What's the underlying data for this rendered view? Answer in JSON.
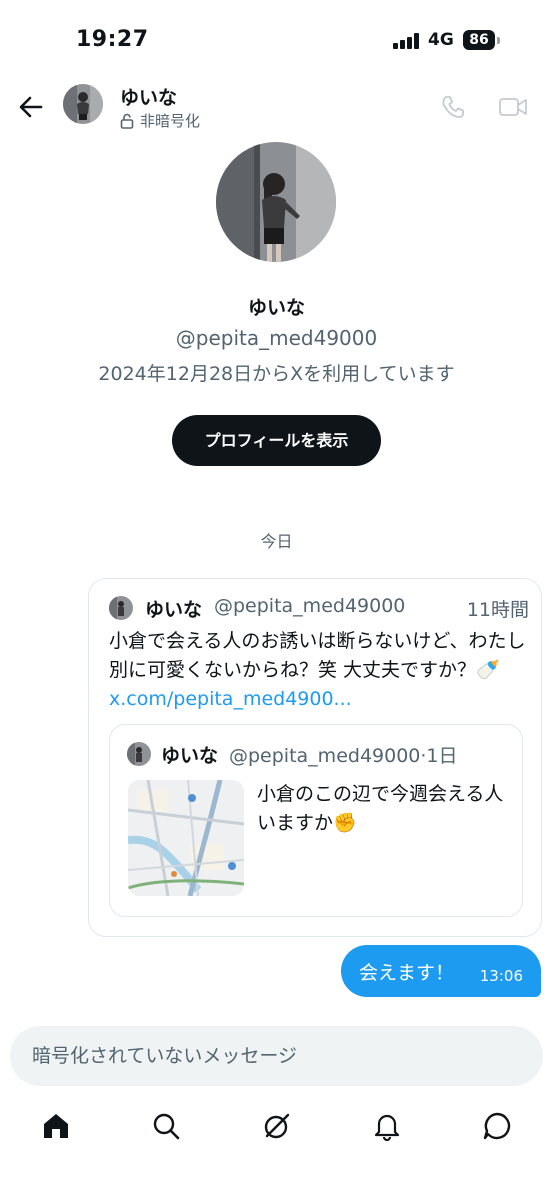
{
  "status_bar": {
    "time": "19:27",
    "network": "4G",
    "battery": "86"
  },
  "header": {
    "name": "ゆいな",
    "encryption": "非暗号化"
  },
  "profile": {
    "name": "ゆいな",
    "handle": "@pepita_med49000",
    "joined": "2024年12月28日からXを利用しています",
    "view_profile_button": "プロフィールを表示"
  },
  "date_separator": "今日",
  "shared_post": {
    "name": "ゆいな",
    "handle": "@pepita_med49000",
    "time": "11時間",
    "text": "小倉で会える人のお誘いは断らないけど、わたし別に可愛くないからね？笑 大丈夫ですか？🍼 ",
    "link": "x.com/pepita_med4900...",
    "quote": {
      "name": "ゆいな",
      "handle": "@pepita_med49000·1日",
      "text": "小倉のこの辺で今週会える人いますか✊"
    }
  },
  "sent_message": {
    "text": "会えます！",
    "time": "13:06"
  },
  "composer": {
    "placeholder": "暗号化されていないメッセージ"
  },
  "nav": {
    "items": [
      "home-icon",
      "search-icon",
      "grok-icon",
      "notifications-icon",
      "messages-icon"
    ]
  },
  "colors": {
    "accent": "#1d9bf0",
    "text": "#0f1419",
    "secondary": "#536471",
    "button_dark": "#0f1419"
  }
}
